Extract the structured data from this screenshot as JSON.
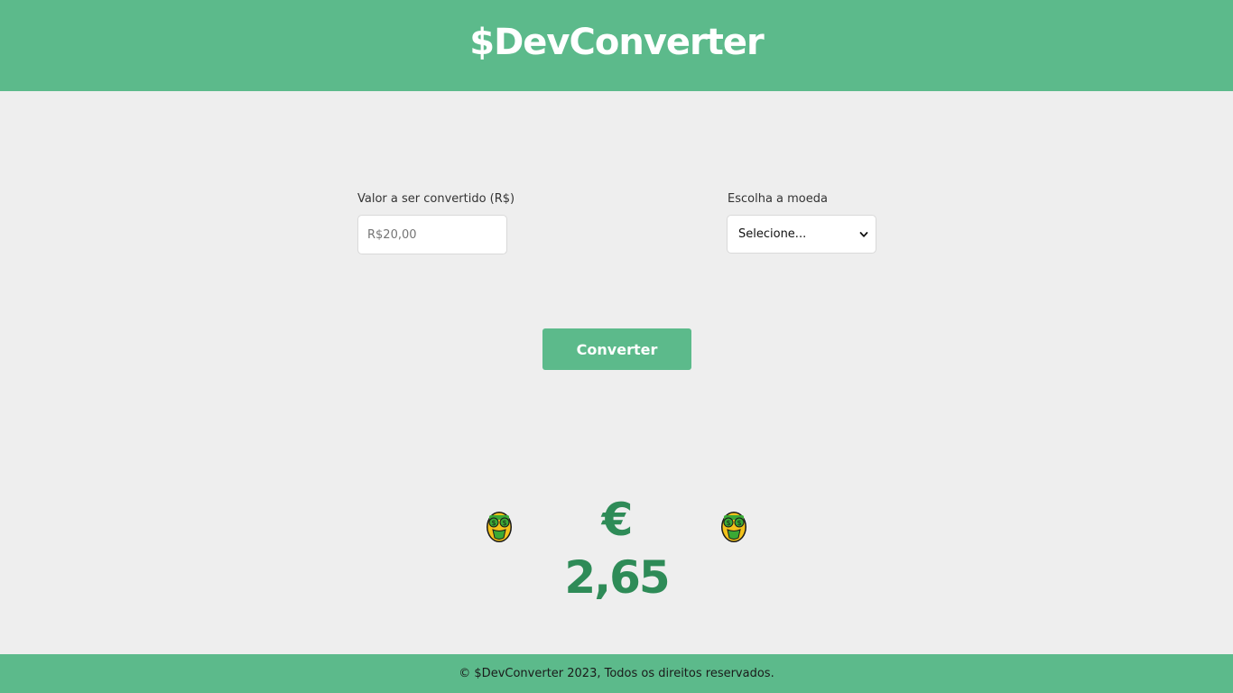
{
  "header": {
    "title": "$DevConverter"
  },
  "form": {
    "value_label": "Valor a ser convertido (R$)",
    "value_placeholder": "R$20,00",
    "value_input": "",
    "currency_label": "Escolha a moeda",
    "currency_selected": "Selecione..."
  },
  "actions": {
    "convert_label": "Converter"
  },
  "result": {
    "value": "€ 2,65",
    "icon_left": "money-mouth-face-icon",
    "icon_right": "money-mouth-face-icon"
  },
  "footer": {
    "text": "© $DevConverter 2023, Todos os direitos reservados."
  },
  "colors": {
    "brand_green": "#5cba8b",
    "result_green": "#2e8b57",
    "background": "#eeeeee"
  }
}
